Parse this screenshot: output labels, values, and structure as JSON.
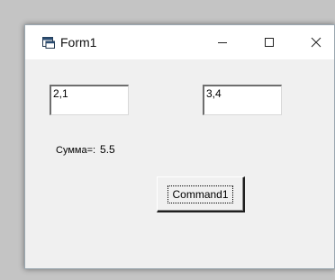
{
  "window": {
    "title": "Form1",
    "icon": "vb-form-icon"
  },
  "controls": {
    "minimize": "minimize-icon",
    "maximize": "maximize-icon",
    "close": "close-icon"
  },
  "form": {
    "text1": "2,1",
    "text2": "3,4",
    "sum_label": "Сумма=:",
    "sum_value": "5.5",
    "command_button": "Command1"
  }
}
